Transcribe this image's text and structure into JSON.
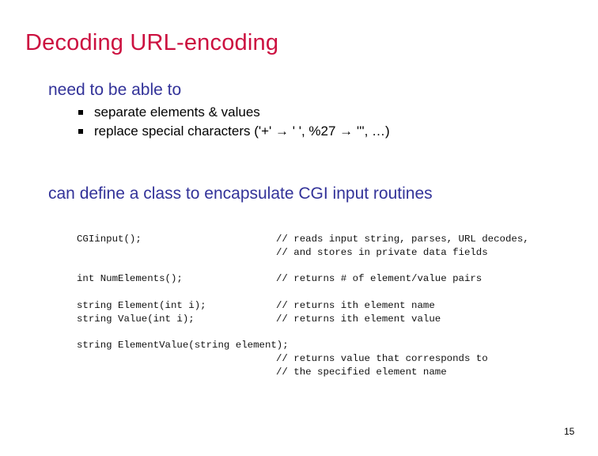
{
  "slide": {
    "title": "Decoding URL-encoding",
    "page_number": "15",
    "colors": {
      "title": "#cc1040",
      "heading": "#333399",
      "body": "#000000"
    }
  },
  "points": [
    {
      "text": "need to be able to",
      "bullets": [
        "separate elements & values",
        "replace special characters ('+' → ' ', %27 → ''', …)"
      ]
    },
    {
      "text": "can define a class to encapsulate CGI input routines"
    }
  ],
  "code": [
    {
      "signature": "CGIinput();",
      "comments": [
        "// reads input string, parses, URL decodes,",
        "// and stores in private data fields"
      ]
    },
    {
      "signature": "int NumElements();",
      "comments": [
        "// returns # of element/value pairs"
      ]
    },
    {
      "signature": "string Element(int i);",
      "comments": [
        "// returns ith element name"
      ]
    },
    {
      "signature": "string Value(int i);",
      "comments": [
        "// returns ith element value"
      ]
    },
    {
      "signature": "string ElementValue(string element);",
      "comments": [
        "// returns value that corresponds to",
        "// the specified element name"
      ]
    }
  ]
}
